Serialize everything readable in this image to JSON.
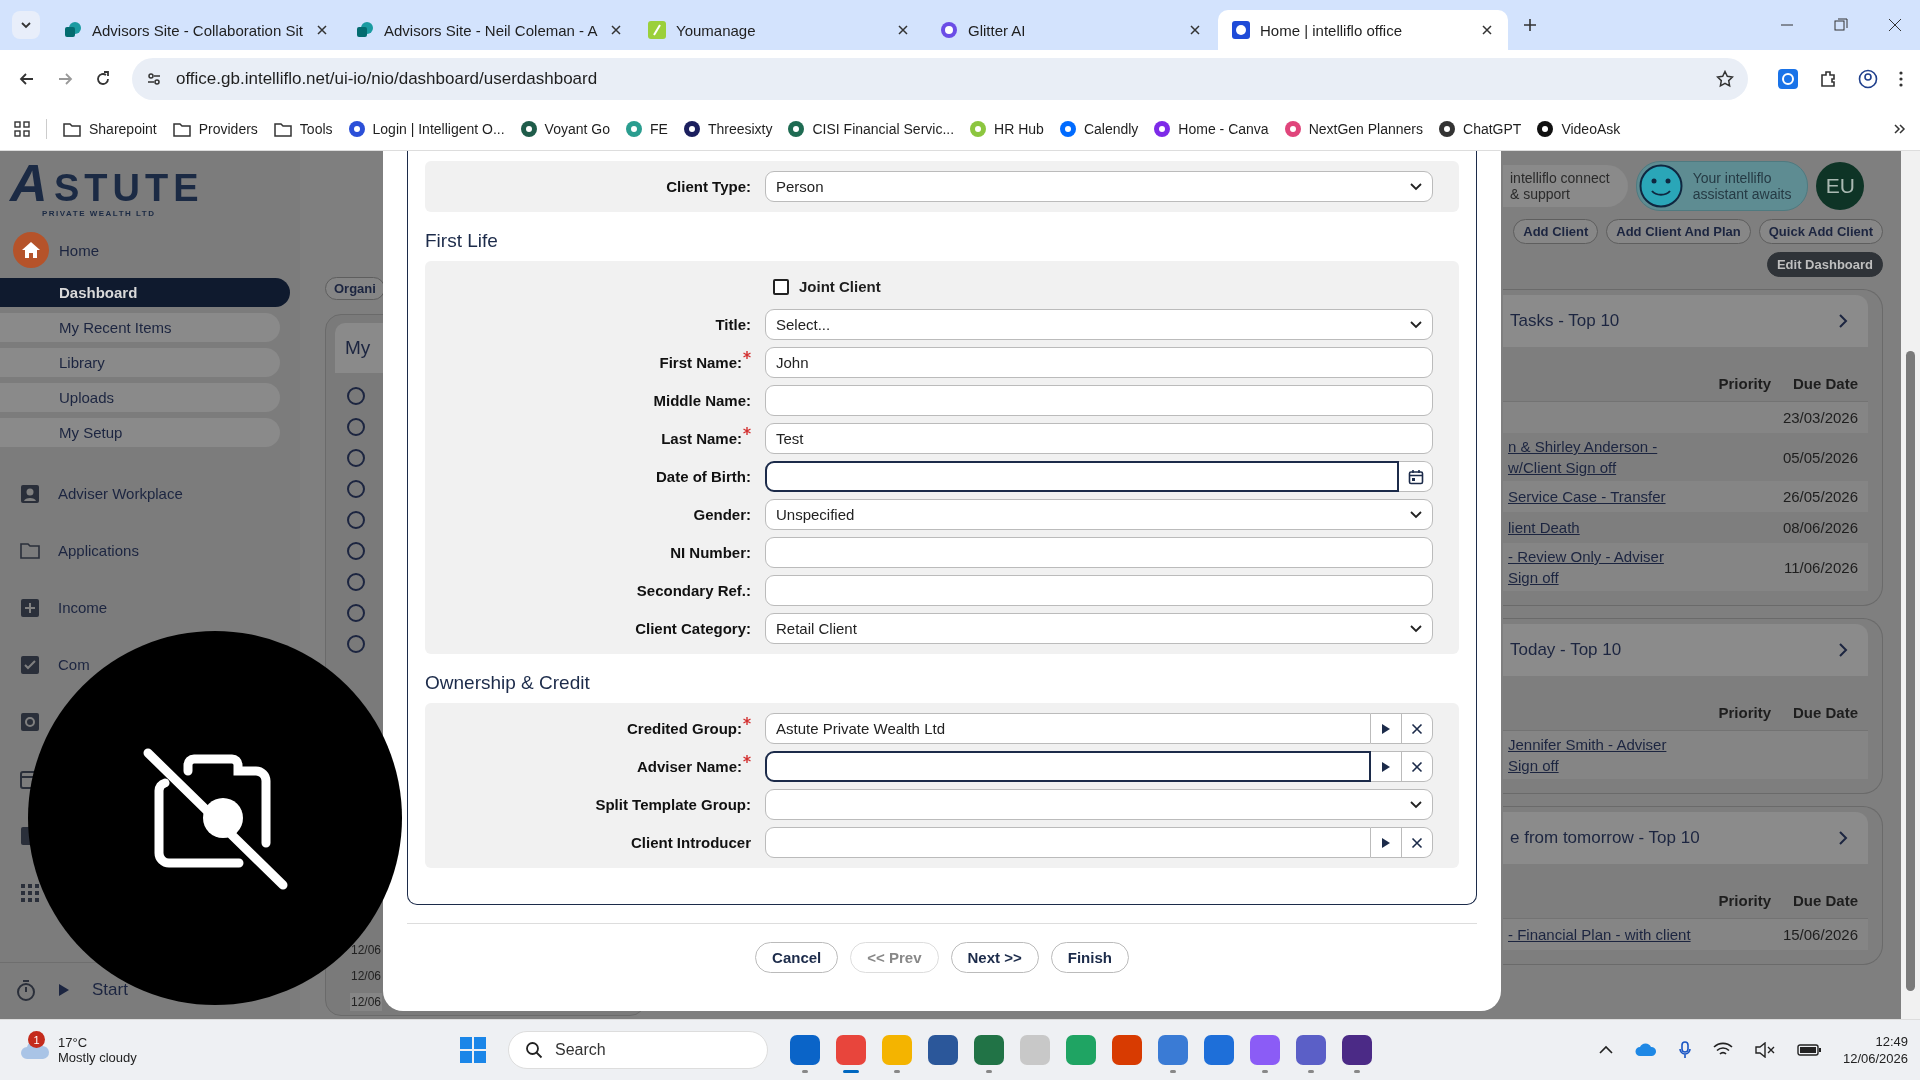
{
  "browser": {
    "tabs": [
      {
        "title": "Advisors Site - Collaboration Sit",
        "selected": false
      },
      {
        "title": "Advisors Site - Neil Coleman - A",
        "selected": false
      },
      {
        "title": "Youmanage",
        "selected": false
      },
      {
        "title": "Glitter AI",
        "selected": false
      },
      {
        "title": "Home | intelliflo office",
        "selected": true
      }
    ],
    "address": "office.gb.intelliflo.net/ui-io/nio/dashboard/userdashboard",
    "bookmarks": [
      {
        "label": "Sharepoint",
        "kind": "folder"
      },
      {
        "label": "Providers",
        "kind": "folder"
      },
      {
        "label": "Tools",
        "kind": "folder"
      },
      {
        "label": "Login | Intelligent O...",
        "kind": "site",
        "color": "#2b4fd8"
      },
      {
        "label": "Voyant Go",
        "kind": "site",
        "color": "#1f5c4a"
      },
      {
        "label": "FE",
        "kind": "site",
        "color": "#2a9d8f"
      },
      {
        "label": "Threesixty",
        "kind": "site",
        "color": "#1b1f5e"
      },
      {
        "label": "CISI Financial Servic...",
        "kind": "site",
        "color": "#1e6b52"
      },
      {
        "label": "HR Hub",
        "kind": "site",
        "color": "#8cc63f"
      },
      {
        "label": "Calendly",
        "kind": "site",
        "color": "#006bff"
      },
      {
        "label": "Home - Canva",
        "kind": "site",
        "color": "#7d2ae8"
      },
      {
        "label": "NextGen Planners",
        "kind": "site",
        "color": "#e0457b"
      },
      {
        "label": "ChatGPT",
        "kind": "site",
        "color": "#333333"
      },
      {
        "label": "VideoAsk",
        "kind": "site",
        "color": "#111111"
      }
    ]
  },
  "sidebar": {
    "logo": "STUTE",
    "logo_letter": "A",
    "tagline": "PRIVATE WEALTH LTD",
    "home": "Home",
    "subitems": [
      {
        "label": "Dashboard",
        "selected": true
      },
      {
        "label": "My Recent Items",
        "selected": false
      },
      {
        "label": "Library",
        "selected": false
      },
      {
        "label": "Uploads",
        "selected": false
      },
      {
        "label": "My Setup",
        "selected": false
      }
    ],
    "nav": [
      "Adviser Workplace",
      "Applications",
      "Income",
      "Com"
    ],
    "start": "Start"
  },
  "middle": {
    "chip": "Organi",
    "panel_title": "My",
    "radios": [
      {
        "checked": false
      },
      {
        "checked": false
      },
      {
        "checked": false
      },
      {
        "checked": false
      },
      {
        "checked": false
      },
      {
        "checked": false
      },
      {
        "checked": false
      },
      {
        "checked": false
      },
      {
        "checked": false
      }
    ],
    "dates": [
      "12/06",
      "12/06",
      "12/06"
    ]
  },
  "right": {
    "connect": [
      "intelliflo connect",
      "& support"
    ],
    "assistant": [
      "Your intelliflo",
      "assistant awaits"
    ],
    "avatar": "EU",
    "buttons": [
      "Add Client",
      "Add Client And Plan",
      "Quick Add Client"
    ],
    "edit": "Edit Dashboard",
    "panels": [
      {
        "title": "Tasks - Top 10",
        "columns": [
          "Priority",
          "Due Date"
        ],
        "rows": [
          {
            "lines": [],
            "date": "23/03/2026"
          },
          {
            "lines": [
              "n & Shirley Anderson -",
              "w/Client Sign off"
            ],
            "date": "05/05/2026"
          },
          {
            "lines": [
              "Service Case - Transfer"
            ],
            "date": "26/05/2026"
          },
          {
            "lines": [
              "lient Death"
            ],
            "date": "08/06/2026"
          },
          {
            "lines": [
              "- Review Only - Adviser",
              "Sign off"
            ],
            "date": "11/06/2026"
          }
        ]
      },
      {
        "title": "Today - Top 10",
        "columns": [
          "Priority",
          "Due Date"
        ],
        "rows": [
          {
            "lines": [
              "Jennifer Smith - Adviser",
              "Sign off"
            ]
          }
        ]
      },
      {
        "title": "e from tomorrow - Top 10",
        "columns": [
          "Priority",
          "Due Date"
        ],
        "rows": [
          {
            "lines": [
              "- Financial Plan - with client"
            ],
            "date": "15/06/2026"
          }
        ]
      }
    ]
  },
  "modal": {
    "sections": [
      {
        "fields": [
          {
            "label": "Client Type:",
            "kind": "select",
            "value": "Person",
            "required": false,
            "focused": false
          }
        ]
      },
      {
        "heading": "First Life",
        "fields": [
          {
            "label": "Joint Client",
            "kind": "checkbox",
            "checked": false
          },
          {
            "label": "Title:",
            "kind": "select",
            "value": "Select...",
            "required": false,
            "focused": false
          },
          {
            "label": "First Name:",
            "kind": "text",
            "value": "John",
            "required": true,
            "focused": false
          },
          {
            "label": "Middle Name:",
            "kind": "text",
            "required": false,
            "focused": false
          },
          {
            "label": "Last Name:",
            "kind": "text",
            "value": "Test",
            "required": true,
            "focused": false
          },
          {
            "label": "Date of Birth:",
            "kind": "date",
            "required": false,
            "focused": true
          },
          {
            "label": "Gender:",
            "kind": "select",
            "value": "Unspecified",
            "required": false,
            "focused": false
          },
          {
            "label": "NI Number:",
            "kind": "text",
            "required": false,
            "focused": false
          },
          {
            "label": "Secondary Ref.:",
            "kind": "text",
            "required": false,
            "focused": false
          },
          {
            "label": "Client Category:",
            "kind": "select",
            "value": "Retail Client",
            "required": false,
            "focused": false
          }
        ]
      },
      {
        "heading": "Ownership & Credit",
        "fields": [
          {
            "label": "Credited Group:",
            "kind": "lookup",
            "value": "Astute Private Wealth Ltd",
            "required": true,
            "focused": false
          },
          {
            "label": "Adviser Name:",
            "kind": "lookup",
            "required": true,
            "focused": true
          },
          {
            "label": "Split Template Group:",
            "kind": "select",
            "required": false,
            "focused": false
          },
          {
            "label": "Client Introducer",
            "kind": "lookup",
            "required": false,
            "focused": false
          }
        ]
      }
    ],
    "buttons": [
      {
        "label": "Cancel",
        "disabled": false
      },
      {
        "label": "<< Prev",
        "disabled": true
      },
      {
        "label": "Next >>",
        "disabled": false
      },
      {
        "label": "Finish",
        "disabled": false
      }
    ]
  },
  "taskbar": {
    "weather": {
      "temp": "17°C",
      "text": "Mostly cloudy",
      "badge": "1"
    },
    "search": "Search",
    "apps": [
      {
        "color": "#0a64c8",
        "running": true,
        "active": false
      },
      {
        "color": "#e8453c",
        "running": true,
        "active": true
      },
      {
        "color": "#f4b400",
        "running": true,
        "active": false
      },
      {
        "color": "#2b579a",
        "running": false,
        "active": false
      },
      {
        "color": "#217346",
        "running": true,
        "active": false
      },
      {
        "color": "#c8c8c8",
        "running": false,
        "active": false
      },
      {
        "color": "#1fa463",
        "running": false,
        "active": false
      },
      {
        "color": "#d83b01",
        "running": false,
        "active": false
      },
      {
        "color": "#3a7bd5",
        "running": true,
        "active": false
      },
      {
        "color": "#1e6fd9",
        "running": false,
        "active": false
      },
      {
        "color": "#8b5cf6",
        "running": true,
        "active": false
      },
      {
        "color": "#5b5fc7",
        "running": true,
        "active": false
      },
      {
        "color": "#4b2a86",
        "running": true,
        "active": false
      }
    ],
    "time": "12:49",
    "date": "12/06/2026"
  }
}
